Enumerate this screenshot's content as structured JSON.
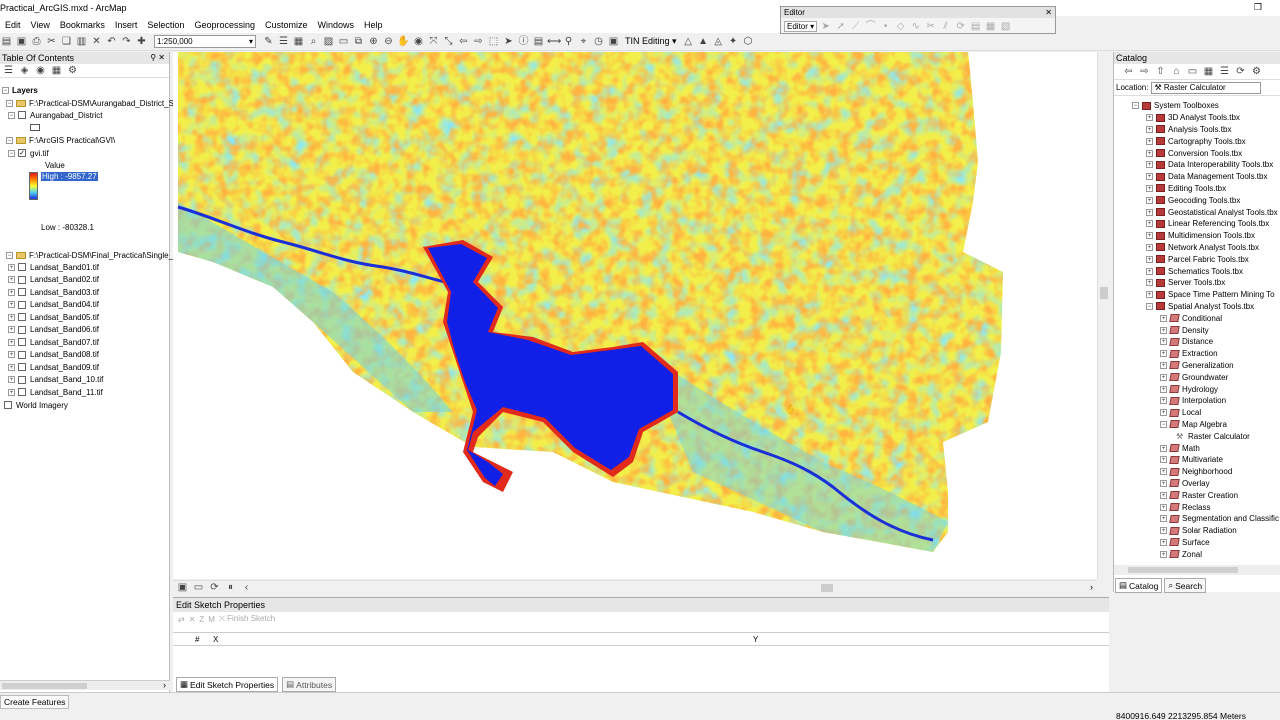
{
  "window": {
    "title": "Practical_ArcGIS.mxd - ArcMap",
    "restore_glyph": "❐"
  },
  "menu": [
    "Edit",
    "View",
    "Bookmarks",
    "Insert",
    "Selection",
    "Geoprocessing",
    "Customize",
    "Windows",
    "Help"
  ],
  "toolbar": {
    "scale": "1:250,000",
    "tin_editing": "TIN Editing ▾"
  },
  "editor": {
    "title": "Editor",
    "dropdown": "Editor ▾"
  },
  "toc": {
    "title": "Table Of Contents",
    "layers_label": "Layers",
    "group1_path": "F:\\Practical-DSM\\Aurangabad_District_Sh",
    "aurangabad": "Aurangabad_District",
    "group2_path": "F:\\ArcGIS Practical\\GVI\\",
    "gvi": "gvi.tif",
    "value_label": "Value",
    "high": "High : -9857.27",
    "low": "Low : -80328.1",
    "group3_path": "F:\\Practical-DSM\\Final_Practical\\Single_b",
    "bands": [
      "Landsat_Band01.tif",
      "Landsat_Band02.tif",
      "Landsat_Band03.tif",
      "Landsat_Band04.tif",
      "Landsat_Band05.tif",
      "Landsat_Band06.tif",
      "Landsat_Band07.tif",
      "Landsat_Band08.tif",
      "Landsat_Band09.tif",
      "Landsat_Band_10.tif",
      "Landsat_Band_11.tif"
    ],
    "world_imagery": "World Imagery"
  },
  "sketch": {
    "title": "Edit Sketch Properties",
    "finish": "Finish Sketch",
    "col_num": "#",
    "col_x": "X",
    "col_y": "Y",
    "tab_edit": "Edit Sketch Properties",
    "tab_attr": "Attributes"
  },
  "catalog": {
    "title": "Catalog",
    "location_label": "Location:",
    "location_value": "Raster Calculator",
    "system_toolboxes": "System Toolboxes",
    "toolboxes": [
      "3D Analyst Tools.tbx",
      "Analysis Tools.tbx",
      "Cartography Tools.tbx",
      "Conversion Tools.tbx",
      "Data Interoperability Tools.tbx",
      "Data Management Tools.tbx",
      "Editing Tools.tbx",
      "Geocoding Tools.tbx",
      "Geostatistical Analyst Tools.tbx",
      "Linear Referencing Tools.tbx",
      "Multidimension Tools.tbx",
      "Network Analyst Tools.tbx",
      "Parcel Fabric Tools.tbx",
      "Schematics Tools.tbx",
      "Server Tools.tbx",
      "Space Time Pattern Mining To",
      "Spatial Analyst Tools.tbx"
    ],
    "spatial_sets_a": [
      "Conditional",
      "Density",
      "Distance",
      "Extraction",
      "Generalization",
      "Groundwater",
      "Hydrology",
      "Interpolation",
      "Local",
      "Map Algebra"
    ],
    "raster_calculator": "Raster Calculator",
    "spatial_sets_b": [
      "Math",
      "Multivariate",
      "Neighborhood",
      "Overlay",
      "Raster Creation",
      "Reclass",
      "Segmentation and Classific",
      "Solar Radiation",
      "Surface",
      "Zonal"
    ],
    "tab_catalog": "Catalog",
    "tab_search": "Search"
  },
  "status": {
    "left": "Create Features",
    "coords": "8400916.649  2213295.854 Meters"
  }
}
